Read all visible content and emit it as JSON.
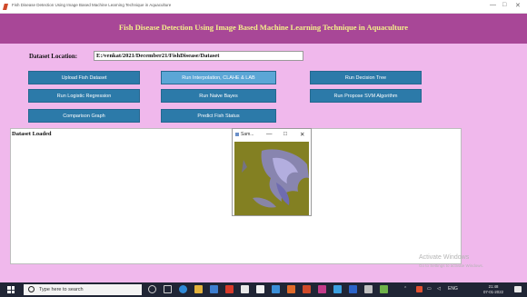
{
  "window": {
    "title": "Fish Disease Detection Using Image Based Machine Learning Technique in Aquaculture",
    "controls": {
      "minimize": "—",
      "maximize": "□",
      "close": "✕"
    }
  },
  "header": {
    "title": "Fish Disease Detection Using Image Based Machine Learning Technique in Aquaculture"
  },
  "location": {
    "label": "Dataset Location:",
    "value": "E:/venkat/2021/December21/FishDisease/Dataset"
  },
  "buttons": {
    "upload": "Upload Fish Dataset",
    "interpolation": "Run Interpolation, CLAHE & LAB",
    "decision_tree": "Run Decision Tree",
    "logistic": "Run Logistic Regression",
    "naive_bayes": "Run Naive Bayes",
    "svm": "Run Propose SVM Algorithm",
    "comparison": "Comparison Graph",
    "predict": "Predict Fish Status"
  },
  "output": {
    "text": "Dataset Loaded"
  },
  "popup": {
    "title": "Sam...",
    "controls": {
      "minimize": "—",
      "maximize": "□",
      "close": "✕"
    }
  },
  "watermark": {
    "line1": "Activate Windows",
    "line2": "Go to Settings to activate Windows."
  },
  "taskbar": {
    "search_placeholder": "Type here to search",
    "tray_lang": "ENG",
    "time": "21:48",
    "date": "07-01-2022"
  },
  "colors": {
    "background": "#f0b8ec",
    "header": "#a84797",
    "header_text": "#f4f08a",
    "button": "#2c7aa9",
    "button_active": "#5ba6d6",
    "taskbar": "#202535"
  }
}
